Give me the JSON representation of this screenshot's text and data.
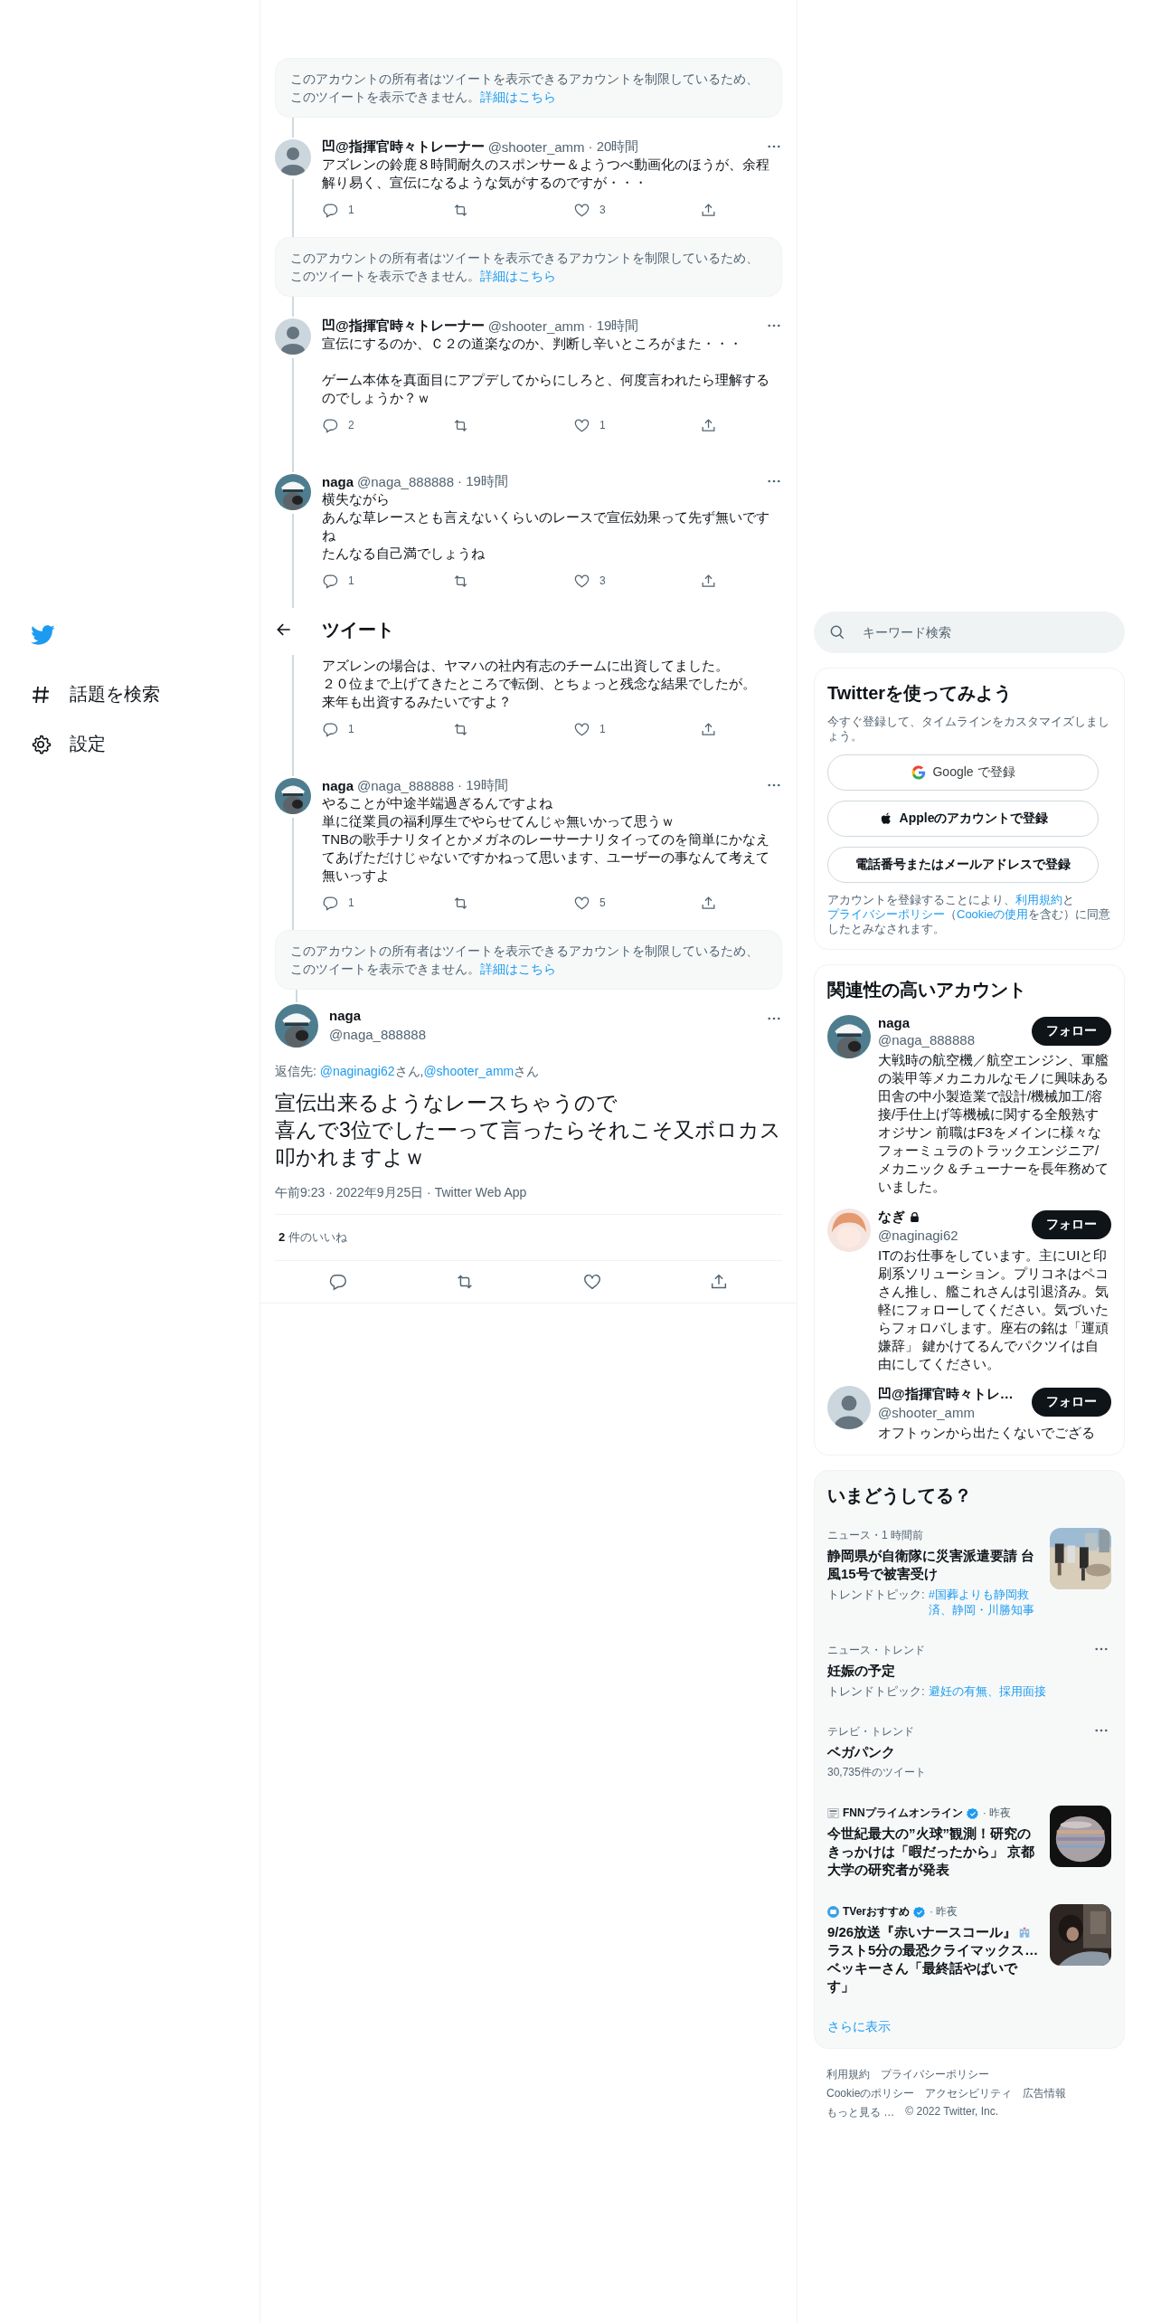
{
  "nav": {
    "items": [
      {
        "kind": "hashtag",
        "label": "話題を検索"
      },
      {
        "kind": "settings",
        "label": "設定"
      }
    ]
  },
  "thread": [
    {
      "kind": "notice",
      "text": "このアカウントの所有者はツイートを表示できるアカウントを制限しているため、このツイートを表示できません。",
      "link": "詳細はこちら"
    },
    {
      "kind": "tweet",
      "name": "凹@指揮官時々トレーナー",
      "handle": "@shooter_amm",
      "time": "· 20時間",
      "paragraphs": [
        [
          "アズレンの鈴鹿８時間耐久のスポンサー＆ようつべ動画化のほうが、余程解り易く、宣伝になるような気がするのですが・・・"
        ]
      ],
      "replies": "1",
      "likes": "3"
    },
    {
      "kind": "notice",
      "text": "このアカウントの所有者はツイートを表示できるアカウントを制限しているため、このツイートを表示できません。",
      "link": "詳細はこちら"
    },
    {
      "kind": "tweet",
      "name": "凹@指揮官時々トレーナー",
      "handle": "@shooter_amm",
      "time": "· 19時間",
      "paragraphs": [
        [
          "宣伝にするのか、Ｃ２の道楽なのか、判断し辛いところがまた・・・"
        ],
        [
          "ゲーム本体を真面目にアプデしてからにしろと、何度言われたら理解するのでしょうか？ｗ"
        ]
      ],
      "replies": "2",
      "likes": "1"
    },
    {
      "kind": "tweet",
      "name": "naga",
      "handle": "@naga_888888",
      "time": "· 19時間",
      "paragraphs": [
        [
          "横失ながら",
          "あんな草レースとも言えないくらいのレースで宣伝効果って先ず無いですね",
          "たんなる自己満でしょうね"
        ]
      ],
      "replies": "1",
      "likes": "3"
    },
    {
      "kind": "header",
      "title": "ツイート"
    },
    {
      "kind": "partial",
      "paragraphs": [
        [
          "アズレンの場合は、ヤマハの社内有志のチームに出資してました。",
          "２０位まで上げてきたところで転倒、とちょっと残念な結果でしたが。",
          "来年も出資するみたいですよ？"
        ]
      ],
      "replies": "1",
      "likes": "1"
    },
    {
      "kind": "tweet",
      "name": "naga",
      "handle": "@naga_888888",
      "time": "· 19時間",
      "paragraphs": [
        [
          "やることが中途半端過ぎるんですよね",
          "単に従業員の福利厚生でやらせてんじゃ無いかって思うｗ",
          "TNBの歌手ナリタイとかメガネのレーサーナリタイってのを簡単にかなえてあげただけじゃないですかねって思います、ユーザーの事なんて考えて無いっすよ"
        ]
      ],
      "replies": "1",
      "likes": "5"
    },
    {
      "kind": "notice",
      "text": "このアカウントの所有者はツイートを表示できるアカウントを制限しているため、このツイートを表示できません。",
      "link": "詳細はこちら"
    },
    {
      "kind": "main",
      "name": "naga",
      "handle": "@naga_888888",
      "reply_label": "返信先:",
      "mentions": [
        {
          "handle": "@naginagi62",
          "suffix": "さん,"
        },
        {
          "handle": "@shooter_amm",
          "suffix": "さん"
        }
      ],
      "lines": [
        "宣伝出来るようなレースちゃうので",
        "喜んで3位でしたーって言ったらそれこそ又ボロカス叩かれますよｗ"
      ],
      "meta": "午前9:23 · 2022年9月25日 · Twitter Web App",
      "like_count": "2",
      "like_label": "件のいいね"
    }
  ],
  "search": {
    "placeholder": "キーワード検索"
  },
  "signup": {
    "title": "Twitterを使ってみよう",
    "subtitle": "今すぐ登録して、タイムラインをカスタマイズしましょう。",
    "buttons": [
      {
        "kind": "google",
        "label": "Google で登録"
      },
      {
        "kind": "apple",
        "label": "Appleのアカウントで登録"
      },
      {
        "kind": "phone",
        "label": "電話番号またはメールアドレスで登録"
      }
    ],
    "legal": [
      {
        "text": "アカウントを登録することにより、"
      },
      {
        "link": "利用規約"
      },
      {
        "text": "と"
      },
      {
        "link": "プライバシーポリシー"
      },
      {
        "text": "（"
      },
      {
        "link": "Cookieの使用"
      },
      {
        "text": "を含む）に同意したとみなされます。"
      }
    ]
  },
  "who_to_follow": {
    "title": "関連性の高いアカウント",
    "accounts": [
      {
        "name": "naga",
        "locked": false,
        "handle": "@naga_888888",
        "button": "フォロー",
        "bio": "大戦時の航空機／航空エンジン、軍艦の装甲等メカニカルなモノに興味ある田舎の中小製造業で設計/機械加工/溶接/手仕上げ等機械に関する全般熟すオジサン 前職はF3をメインに様々なフォーミュラのトラックエンジニア/メカニック＆チューナーを長年務めていました。"
      },
      {
        "name": "なぎ",
        "locked": true,
        "handle": "@naginagi62",
        "button": "フォロー",
        "bio": "ITのお仕事をしています。主にUIと印刷系ソリューション。プリコネはペコさん推し、艦これさんは引退済み。気軽にフォローしてください。気づいたらフォロバします。座右の銘は「運頑嫌辞」 鍵かけてるんでパクツイは自由にしてください。"
      },
      {
        "name": "凹@指揮官時々トレ…",
        "locked": false,
        "handle": "@shooter_amm",
        "button": "フォロー",
        "bio": "オフトゥンから出たくないでござる"
      }
    ]
  },
  "trends": {
    "title": "いまどうしてる？",
    "items": [
      {
        "kind": "news",
        "meta": "ニュース・1 時間前",
        "title": "静岡県が自衛隊に災害派遣要請 台風15号で被害受け",
        "topic_label": "トレンドトピック:",
        "topics": "#国葬よりも静岡救済、静岡・川勝知事"
      },
      {
        "kind": "trend",
        "meta": "ニュース・トレンド",
        "title": "妊娠の予定",
        "topic_label": "トレンドトピック:",
        "topics": "避妊の有無、採用面接"
      },
      {
        "kind": "trend",
        "meta": "テレビ・トレンド",
        "title": "ベガパンク",
        "count": "30,735件のツイート"
      },
      {
        "kind": "source",
        "source": "FNNプライムオンライン",
        "verified": true,
        "time": "· 昨夜",
        "title": "今世紀最大の”火球”観測！研究のきっかけは「暇だったから」 京都大学の研究者が発表"
      },
      {
        "kind": "source",
        "source": "TVerおすすめ",
        "verified": true,
        "time": "· 昨夜",
        "title": "9/26放送『赤いナースコール』",
        "title_rest": "ラスト5分の最恐クライマックス…ベッキーさん「最終話やばいです」"
      }
    ],
    "more": "さらに表示"
  },
  "footer": {
    "links": [
      "利用規約",
      "プライバシーポリシー",
      "Cookieのポリシー",
      "アクセシビリティ",
      "広告情報",
      "もっと見る …"
    ],
    "copyright": "© 2022 Twitter, Inc."
  }
}
